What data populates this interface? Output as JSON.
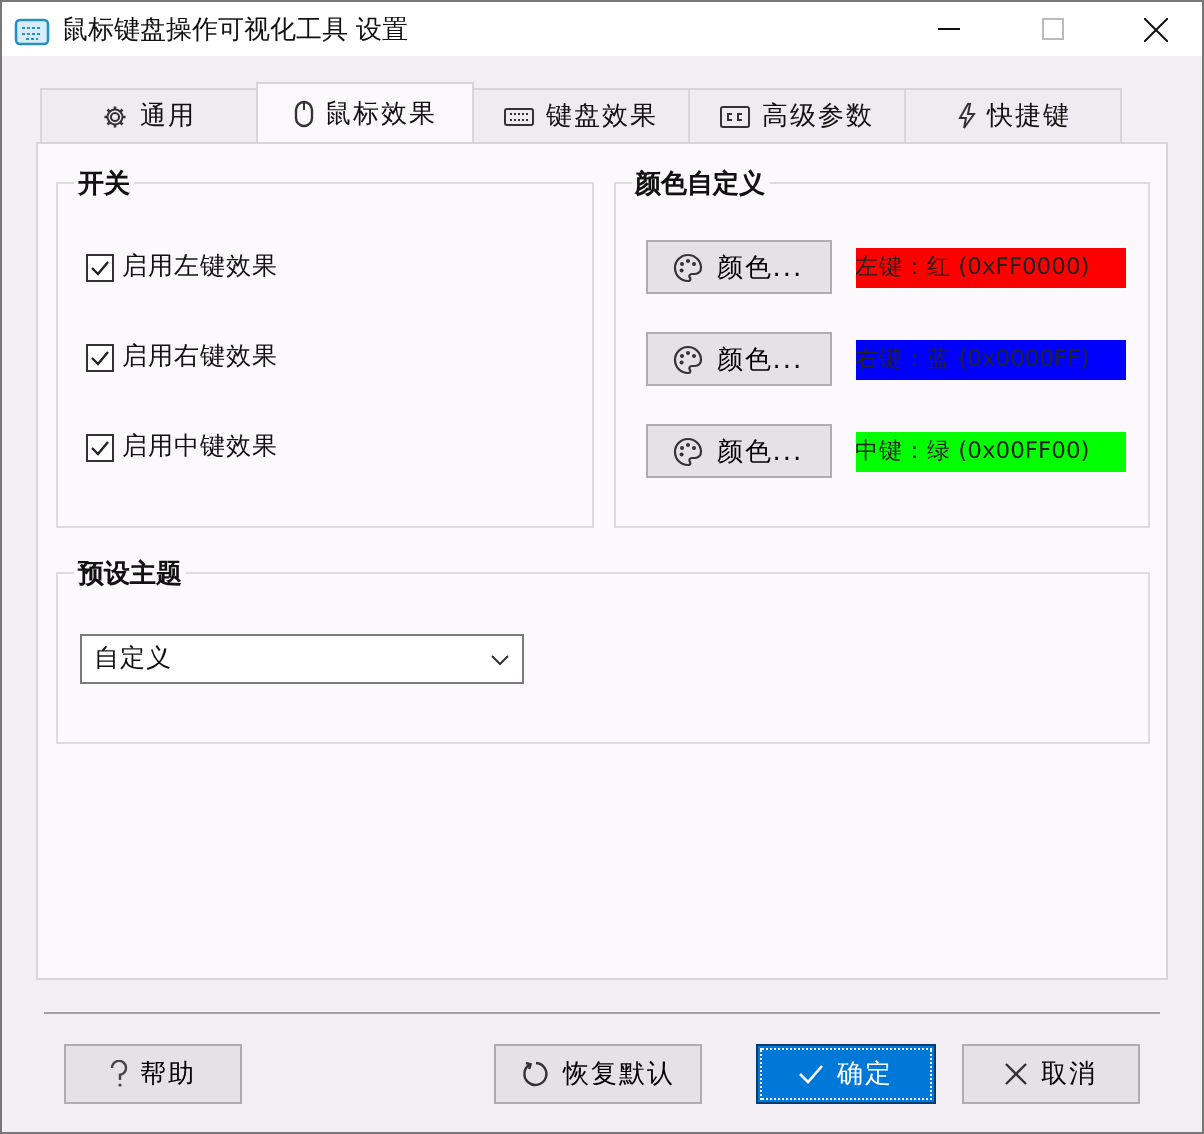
{
  "window": {
    "title": "鼠标键盘操作可视化工具 设置"
  },
  "tabs": [
    {
      "label": "通用",
      "selected": false
    },
    {
      "label": "鼠标效果",
      "selected": true
    },
    {
      "label": "键盘效果",
      "selected": false
    },
    {
      "label": "高级参数",
      "selected": false
    },
    {
      "label": "快捷键",
      "selected": false
    }
  ],
  "switches": {
    "title": "开关",
    "items": [
      {
        "label": "启用左键效果",
        "checked": true
      },
      {
        "label": "启用右键效果",
        "checked": true
      },
      {
        "label": "启用中键效果",
        "checked": true
      }
    ]
  },
  "colors": {
    "title": "颜色自定义",
    "items": [
      {
        "button": "颜色...",
        "label": "左键：红 (0xFF0000)",
        "color": "#ff0000"
      },
      {
        "button": "颜色...",
        "label": "右键：蓝 (0x0000FF)",
        "color": "#0000ff"
      },
      {
        "button": "颜色...",
        "label": "中键：绿 (0x00FF00)",
        "color": "#00ff00"
      }
    ]
  },
  "theme": {
    "title": "预设主题",
    "value": "自定义"
  },
  "buttons": [
    {
      "label": "帮助",
      "primary": false
    },
    {
      "label": "恢复默认",
      "primary": false
    },
    {
      "label": "确定",
      "primary": true
    },
    {
      "label": "取消",
      "primary": false
    }
  ]
}
